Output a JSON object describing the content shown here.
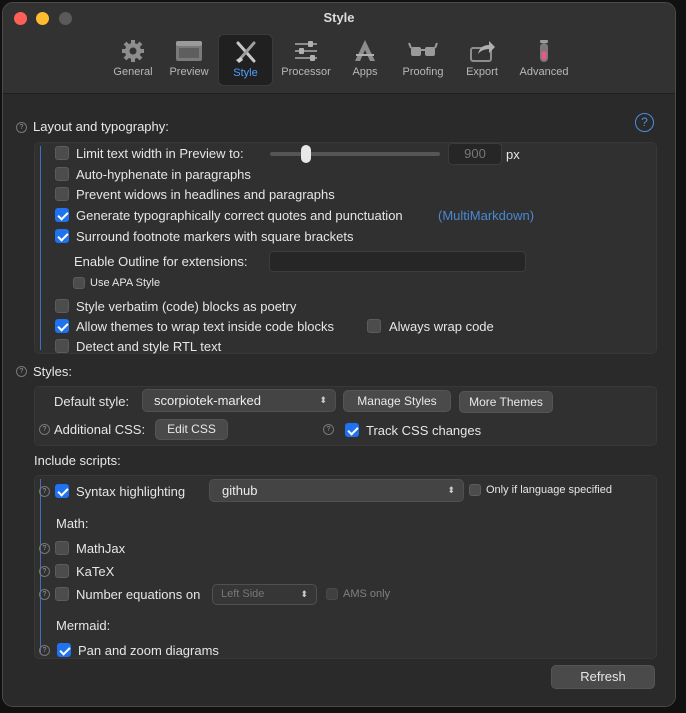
{
  "window": {
    "title": "Style"
  },
  "toolbar": [
    {
      "label": "General",
      "icon": "gear-icon"
    },
    {
      "label": "Preview",
      "icon": "preview-window-icon"
    },
    {
      "label": "Style",
      "icon": "brush-icon",
      "selected": true
    },
    {
      "label": "Processor",
      "icon": "sliders-icon"
    },
    {
      "label": "Apps",
      "icon": "apps-icon"
    },
    {
      "label": "Proofing",
      "icon": "glasses-icon"
    },
    {
      "label": "Export",
      "icon": "export-icon"
    },
    {
      "label": "Advanced",
      "icon": "flask-icon"
    }
  ],
  "layout": {
    "header": "Layout and typography:",
    "limit_width": {
      "label": "Limit text width in Preview to:",
      "checked": false,
      "value": "900",
      "unit": "px",
      "slider_level": 0.2
    },
    "auto_hyphenate": {
      "label": "Auto-hyphenate in paragraphs",
      "checked": false
    },
    "prevent_widows": {
      "label": "Prevent widows in headlines and paragraphs",
      "checked": false
    },
    "typo_quotes": {
      "label": "Generate typographically correct quotes and punctuation",
      "checked": true,
      "note": "(MultiMarkdown)"
    },
    "footnote_brackets": {
      "label": "Surround footnote markers with square brackets",
      "checked": true
    },
    "outline": {
      "label": "Enable Outline for extensions:",
      "value": ""
    },
    "apa_style": {
      "label": "Use APA Style",
      "checked": false
    },
    "verbatim_poetry": {
      "label": "Style verbatim (code) blocks as poetry",
      "checked": false
    },
    "wrap_code": {
      "label": "Allow themes to wrap text inside code blocks",
      "checked": true
    },
    "always_wrap": {
      "label": "Always wrap code",
      "checked": false
    },
    "rtl": {
      "label": "Detect and style RTL text",
      "checked": false
    }
  },
  "styles": {
    "header": "Styles:",
    "default_style_label": "Default style:",
    "default_style_value": "scorpiotek-marked",
    "manage_button": "Manage Styles",
    "more_themes_button": "More Themes",
    "additional_css_label": "Additional CSS:",
    "edit_css_button": "Edit CSS",
    "track_css": {
      "label": "Track CSS changes",
      "checked": true
    }
  },
  "scripts": {
    "header": "Include scripts:",
    "syntax": {
      "label": "Syntax highlighting",
      "checked": true,
      "value": "github"
    },
    "only_if_lang": {
      "label": "Only if language specified",
      "checked": false
    },
    "math_label": "Math:",
    "mathjax": {
      "label": "MathJax",
      "checked": false
    },
    "katex": {
      "label": "KaTeX",
      "checked": false
    },
    "number_eq": {
      "label": "Number equations on",
      "checked": false,
      "value": "Left Side"
    },
    "ams_only": {
      "label": "AMS only",
      "checked": false
    },
    "mermaid_label": "Mermaid:",
    "pan_zoom": {
      "label": "Pan and zoom diagrams",
      "checked": true
    }
  },
  "refresh_button": "Refresh",
  "colors": {
    "accent": "#1f73f0",
    "selected_tab": "#4fa0ff",
    "link": "#4a88d4"
  }
}
